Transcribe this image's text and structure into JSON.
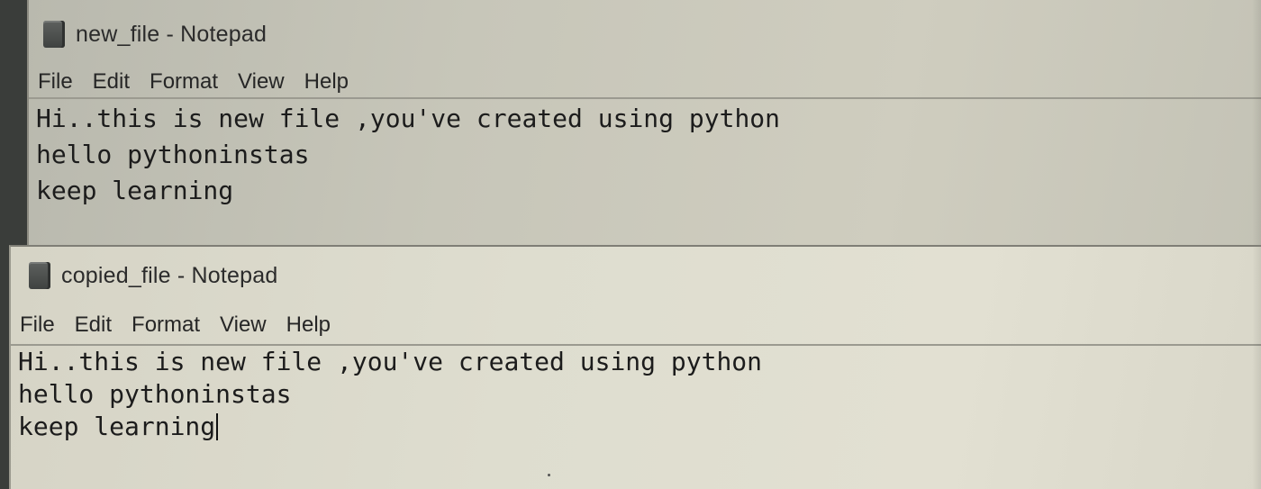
{
  "windows": [
    {
      "title": "new_file - Notepad",
      "icon": "notepad-icon",
      "menu": [
        "File",
        "Edit",
        "Format",
        "View",
        "Help"
      ],
      "content_lines": [
        "Hi..this is new file ,you've created using python",
        "hello pythoninstas",
        "keep learning"
      ]
    },
    {
      "title": "copied_file - Notepad",
      "icon": "notepad-icon",
      "menu": [
        "File",
        "Edit",
        "Format",
        "View",
        "Help"
      ],
      "content_lines": [
        "Hi..this is new file ,you've created using python",
        "hello pythoninstas",
        "keep learning"
      ]
    }
  ]
}
